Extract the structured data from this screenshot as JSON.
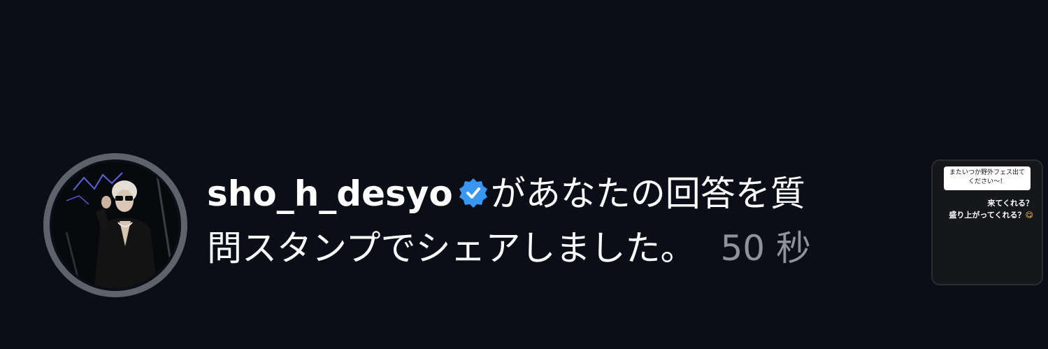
{
  "notification": {
    "username": "sho_h_desyo",
    "verified_icon": "verified-badge-icon",
    "message_line1": "があなたの回答を質",
    "message_line2": "問スタンプでシェアしました。",
    "timestamp": "50 秒",
    "colors": {
      "background": "#0b0e16",
      "text": "#ffffff",
      "timestamp": "#8e939c",
      "verified": "#3897f0",
      "ring": "#5e626b"
    }
  },
  "story_thumbnail": {
    "question": "またいつか野外フェス出てください〜！",
    "answer_line1": "来てくれる？",
    "answer_line2": "盛り上がってくれる？",
    "answer_emoji": "😋"
  }
}
